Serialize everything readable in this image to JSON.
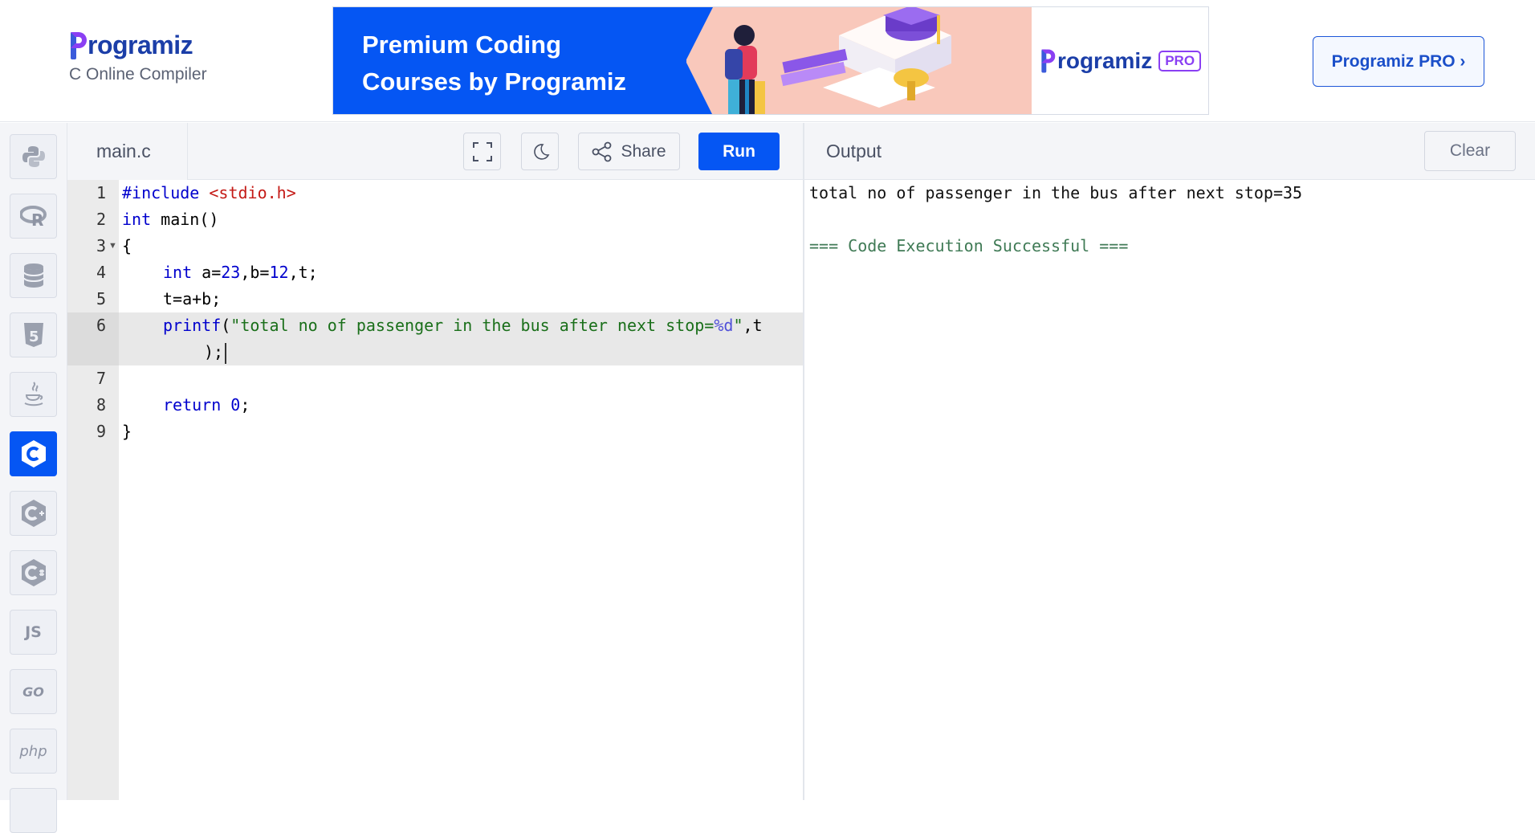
{
  "header": {
    "logo_text": "rogramiz",
    "subtitle": "C Online Compiler",
    "banner": {
      "line1": "Premium Coding",
      "line2": "Courses by Programiz",
      "brand": "rogramiz",
      "badge": "PRO"
    },
    "pro_button": "Programiz PRO ›"
  },
  "sidebar": {
    "languages": [
      {
        "name": "python",
        "label": ""
      },
      {
        "name": "r",
        "label": "R"
      },
      {
        "name": "sql",
        "label": ""
      },
      {
        "name": "html",
        "label": "5"
      },
      {
        "name": "java",
        "label": ""
      },
      {
        "name": "c",
        "label": "C",
        "active": true
      },
      {
        "name": "cpp",
        "label": "C+"
      },
      {
        "name": "csharp",
        "label": "C#"
      },
      {
        "name": "javascript",
        "label": "JS"
      },
      {
        "name": "go",
        "label": "GO"
      },
      {
        "name": "php",
        "label": "php"
      }
    ]
  },
  "editor": {
    "file_name": "main.c",
    "share_label": "Share",
    "run_label": "Run",
    "line_numbers": [
      "1",
      "2",
      "3",
      "4",
      "5",
      "6",
      "7",
      "8",
      "9"
    ],
    "code": {
      "l1_directive": "#include ",
      "l1_header": "<stdio.h>",
      "l2_kw": "int",
      "l2_rest": " main()",
      "l3": "{",
      "l4_kw": "int",
      "l4_a": " a=",
      "l4_n1": "23",
      "l4_b": ",b=",
      "l4_n2": "12",
      "l4_rest": ",t;",
      "l5": "t=a+b;",
      "l6_fn": "printf",
      "l6_open": "(",
      "l6_str": "\"total no of passenger in the bus after next stop=",
      "l6_fmt": "%d",
      "l6_strend": "\"",
      "l6_rest": ",t",
      "l6_wrap": ");",
      "l8_kw": "return",
      "l8_num": "0",
      "l8_rest": ";",
      "l9": "}"
    }
  },
  "output": {
    "title": "Output",
    "clear_label": "Clear",
    "lines": {
      "result": "total no of passenger in the bus after next stop=35",
      "success": "=== Code Execution Successful ==="
    }
  },
  "colors": {
    "accent": "#0556f3",
    "keyword": "#0000cd",
    "string": "#1a6f1a",
    "success": "#3f7a55"
  }
}
